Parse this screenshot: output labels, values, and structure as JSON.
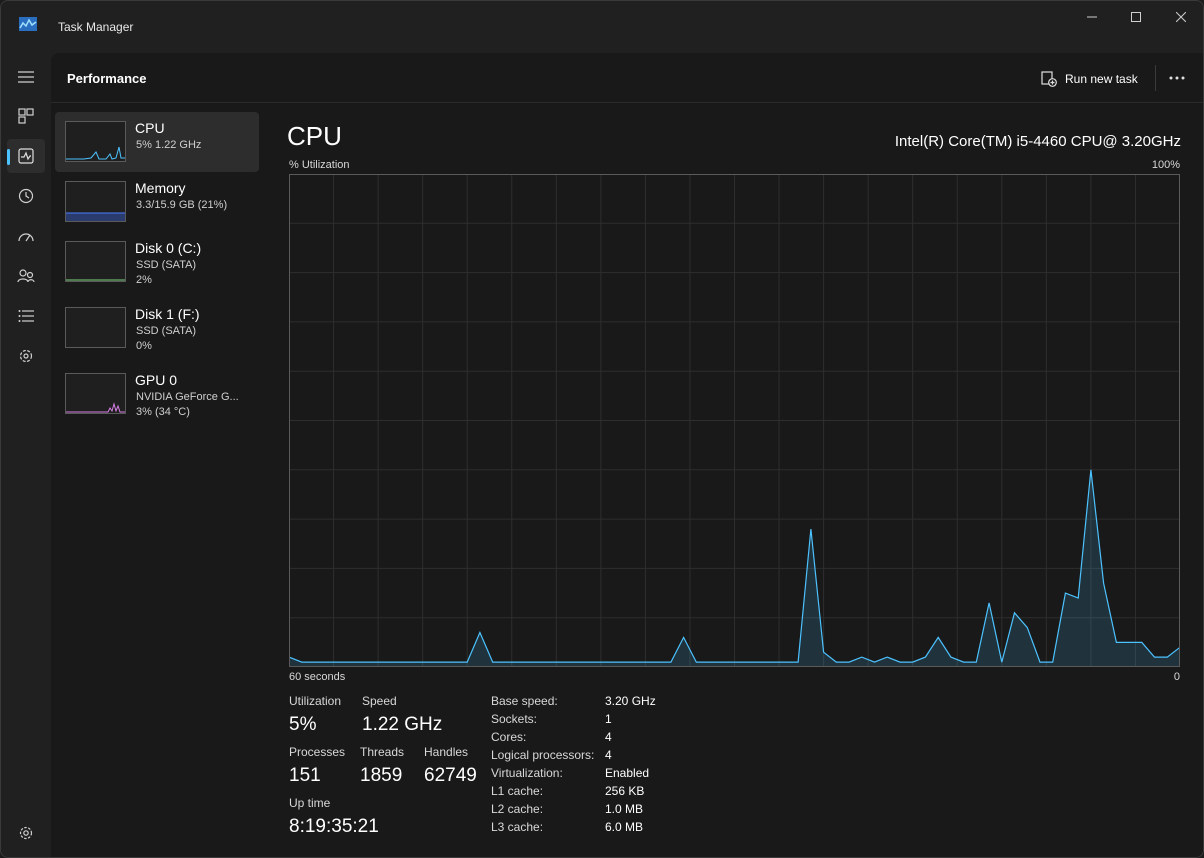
{
  "app": {
    "title": "Task Manager"
  },
  "header": {
    "title": "Performance",
    "run_new_task": "Run new task"
  },
  "nav": {
    "items": [
      {
        "name": "menu-icon"
      },
      {
        "name": "processes-icon"
      },
      {
        "name": "performance-icon",
        "active": true
      },
      {
        "name": "app-history-icon"
      },
      {
        "name": "startup-apps-icon"
      },
      {
        "name": "users-icon"
      },
      {
        "name": "details-icon"
      },
      {
        "name": "services-icon"
      },
      {
        "name": "settings-icon"
      }
    ]
  },
  "devices": [
    {
      "name": "CPU",
      "line1": "5%  1.22 GHz",
      "selected": true,
      "color": "#4cc2ff"
    },
    {
      "name": "Memory",
      "line1": "3.3/15.9 GB (21%)",
      "color": "#4c7dff"
    },
    {
      "name": "Disk 0 (C:)",
      "line1": "SSD (SATA)",
      "line2": "2%",
      "color": "#7fd67f"
    },
    {
      "name": "Disk 1 (F:)",
      "line1": "SSD (SATA)",
      "line2": "0%",
      "color": "#7fd67f"
    },
    {
      "name": "GPU 0",
      "line1": "NVIDIA GeForce G...",
      "line2": "3% (34 °C)",
      "color": "#d77fe6"
    }
  ],
  "cpu": {
    "title": "CPU",
    "model": "Intel(R) Core(TM) i5-4460 CPU@ 3.20GHz",
    "util_label": "% Utilization",
    "max_label": "100%",
    "time_label": "60 seconds",
    "zero_label": "0",
    "stats": {
      "utilization": {
        "label": "Utilization",
        "value": "5%"
      },
      "speed": {
        "label": "Speed",
        "value": "1.22 GHz"
      },
      "processes": {
        "label": "Processes",
        "value": "151"
      },
      "threads": {
        "label": "Threads",
        "value": "1859"
      },
      "handles": {
        "label": "Handles",
        "value": "62749"
      },
      "uptime": {
        "label": "Up time",
        "value": "8:19:35:21"
      }
    },
    "specs": [
      {
        "label": "Base speed:",
        "value": "3.20 GHz"
      },
      {
        "label": "Sockets:",
        "value": "1"
      },
      {
        "label": "Cores:",
        "value": "4"
      },
      {
        "label": "Logical processors:",
        "value": "4"
      },
      {
        "label": "Virtualization:",
        "value": "Enabled"
      },
      {
        "label": "L1 cache:",
        "value": "256 KB"
      },
      {
        "label": "L2 cache:",
        "value": "1.0 MB"
      },
      {
        "label": "L3 cache:",
        "value": "6.0 MB"
      }
    ]
  },
  "chart_data": {
    "type": "area",
    "x_range_seconds": [
      60,
      0
    ],
    "ylim": [
      0,
      100
    ],
    "grid": true,
    "color": "#4cc2ff",
    "values": [
      2,
      1,
      1,
      1,
      1,
      1,
      1,
      1,
      1,
      1,
      1,
      1,
      1,
      1,
      1,
      7,
      1,
      1,
      1,
      1,
      1,
      1,
      1,
      1,
      1,
      1,
      1,
      1,
      1,
      1,
      1,
      6,
      1,
      1,
      1,
      1,
      1,
      1,
      1,
      1,
      1,
      28,
      3,
      1,
      1,
      2,
      1,
      2,
      1,
      1,
      2,
      6,
      2,
      1,
      1,
      13,
      1,
      11,
      8,
      1,
      1,
      15,
      14,
      40,
      17,
      5,
      5,
      5,
      2,
      2,
      4
    ]
  },
  "colors": {
    "accent": "#4cc2ff",
    "memory": "#4c7dff",
    "gpu": "#d77fe6"
  }
}
